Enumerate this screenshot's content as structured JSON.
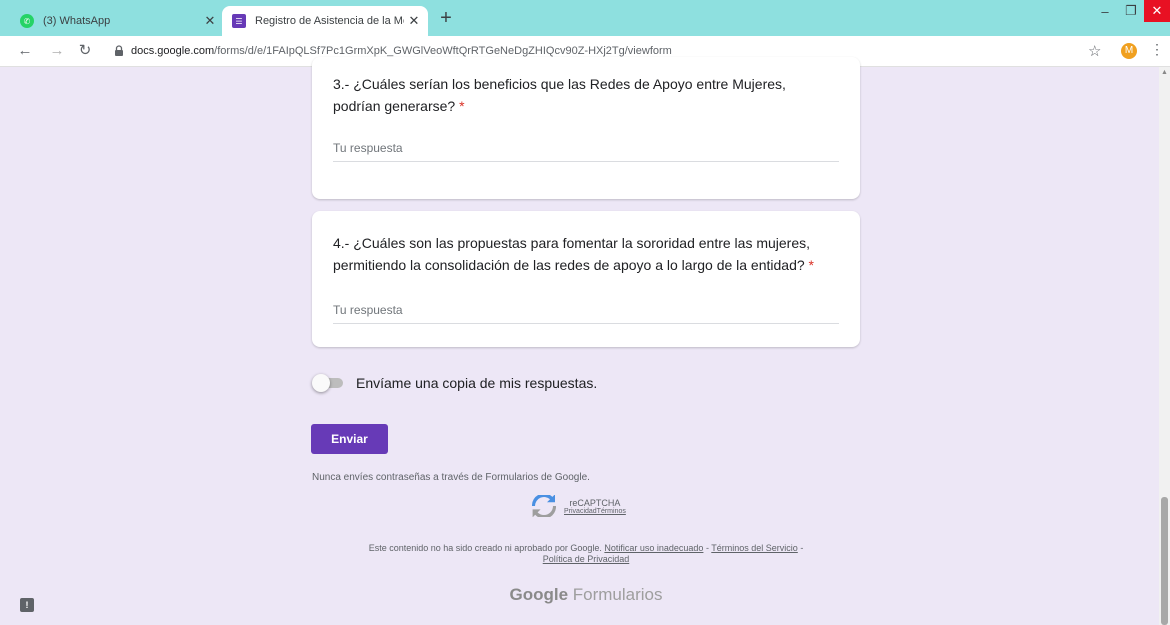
{
  "browser": {
    "tabs": [
      {
        "title": "(3) WhatsApp",
        "active": false,
        "favicon_color": "#25d366"
      },
      {
        "title": "Registro de Asistencia de la Mes",
        "active": true,
        "favicon_color": "#673ab7"
      }
    ],
    "new_tab_label": "+",
    "url_host": "docs.google.com",
    "url_path": "/forms/d/e/1FAIpQLSf7Pc1GrmXpK_GWGlVeoWftQrRTGeNeDgZHIQcv90Z-HXj2Tg/viewform",
    "profile_initial": "M",
    "accent_color": "#8ee0df"
  },
  "form": {
    "questions": [
      {
        "text": "3.- ¿Cuáles serían los beneficios que las Redes de Apoyo entre Mujeres, podrían generarse?",
        "required_mark": "*",
        "placeholder": "Tu respuesta"
      },
      {
        "text": "4.- ¿Cuáles son las propuestas para fomentar la sororidad entre las mujeres, permitiendo la consolidación de las redes de apoyo a lo largo de la entidad?",
        "required_mark": "*",
        "placeholder": "Tu respuesta"
      }
    ],
    "copy_toggle_label": "Envíame una copia de mis respuestas.",
    "submit_label": "Enviar",
    "password_warning": "Nunca envíes contraseñas a través de Formularios de Google.",
    "recaptcha": {
      "title": "reCAPTCHA",
      "links": "PrivacidadTérminos"
    },
    "legal": {
      "prefix": "Este contenido no ha sido creado ni aprobado por Google.",
      "report_link": "Notificar uso inadecuado",
      "sep1": " - ",
      "terms_link": "Términos del Servicio",
      "sep2": " -",
      "privacy_link": "Política de Privacidad"
    },
    "brand_google": "Google",
    "brand_product": "Formularios",
    "theme_color": "#673ab7",
    "background_color": "#ede7f6"
  }
}
